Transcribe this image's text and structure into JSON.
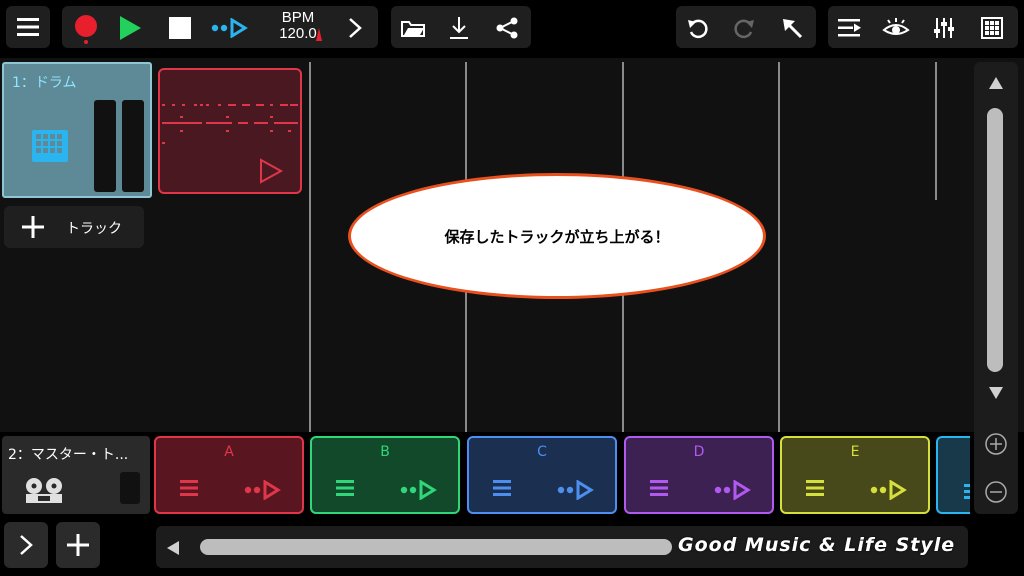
{
  "toolbar": {
    "bpm_label": "BPM",
    "bpm_value": "120.0"
  },
  "tracks": [
    {
      "label": "1：ドラム"
    },
    {
      "label": "2：マスター・ト..."
    }
  ],
  "add_track_label": "トラック",
  "callout_text": "保存したトラックが立ち上がる！",
  "scenes": [
    {
      "label": "A",
      "color": "#e0364a",
      "bg": "#5a1620"
    },
    {
      "label": "B",
      "color": "#2fd67a",
      "bg": "#13492b"
    },
    {
      "label": "C",
      "color": "#4c8ff0",
      "bg": "#1b3050"
    },
    {
      "label": "D",
      "color": "#b25af0",
      "bg": "#3d2152"
    },
    {
      "label": "E",
      "color": "#d6e03a",
      "bg": "#48491a"
    }
  ],
  "watermark": "Good Music & Life Style",
  "colors": {
    "accent_blue": "#2ab4f0",
    "record_red": "#e8202e",
    "play_green": "#21d15c",
    "track_selected": "#5d8a96"
  }
}
